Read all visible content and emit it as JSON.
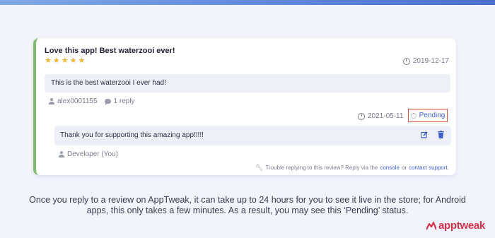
{
  "review": {
    "title": "Love this app! Best waterzooi ever!",
    "stars": [
      "★",
      "★",
      "★",
      "★",
      "★"
    ],
    "rating": 5,
    "date": "2019-12-17",
    "body": "This is the best waterzooi I ever had!",
    "author": "alex0001155",
    "reply_count": "1 reply"
  },
  "reply": {
    "date": "2021-05-11",
    "status": "Pending",
    "text": "Thank you for supporting this amazing app!!!!!",
    "author": "Developer (You)"
  },
  "footer": {
    "trouble_prefix": "Trouble replying to this review? Reply via the",
    "console_link": "console",
    "or_text": "or",
    "support_link": "contact support",
    "period": "."
  },
  "caption": "Once you reply to a review on AppTweak, it can take up to 24 hours for you to see it live in the store; for Android apps, this only takes a few minutes. As a result, you may see this ‘Pending’ status.",
  "brand": {
    "name": "apptweak",
    "color": "#d2354b"
  },
  "colors": {
    "accent_border": "#7fba6f",
    "star": "#f1b434",
    "link": "#3f5fd0",
    "pending_outline": "#d9533b"
  },
  "icons": [
    "clock-icon",
    "user-icon",
    "reply-icon",
    "spinner-icon",
    "edit-icon",
    "trash-icon",
    "wrench-icon"
  ]
}
